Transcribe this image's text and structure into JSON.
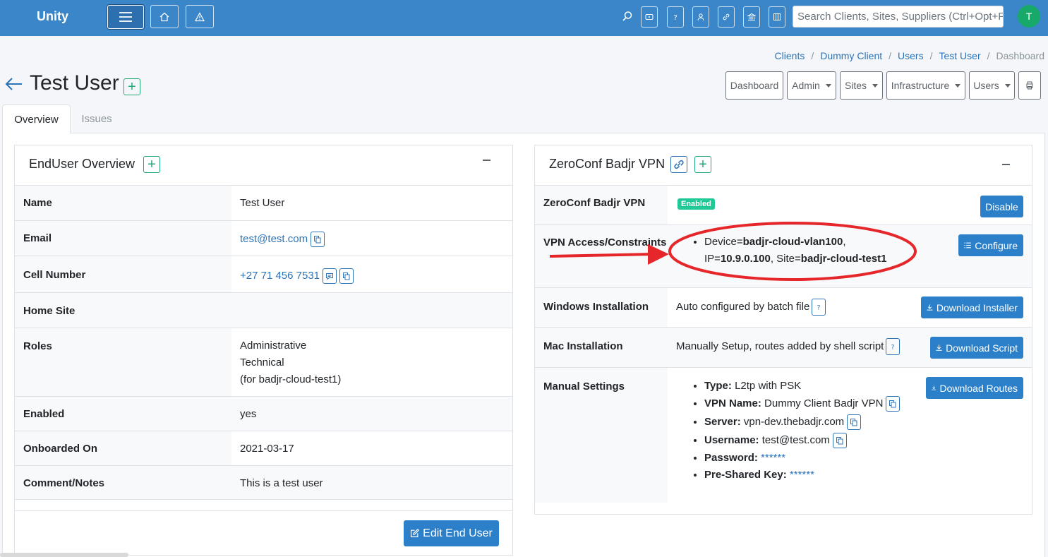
{
  "navbar": {
    "brand": "Unity",
    "search_placeholder": "Search Clients, Sites, Suppliers (Ctrl+Opt+F)",
    "avatar_initial": "T",
    "color": "#3a86c9"
  },
  "breadcrumb": {
    "items": [
      "Clients",
      "Dummy Client",
      "Users",
      "Test User"
    ],
    "current": "Dashboard"
  },
  "page": {
    "title": "Test User",
    "top_buttons": {
      "dashboard": "Dashboard",
      "admin": "Admin",
      "sites": "Sites",
      "infrastructure": "Infrastructure",
      "users": "Users"
    },
    "tabs": {
      "overview": "Overview",
      "issues": "Issues"
    }
  },
  "enduser": {
    "title": "EndUser Overview",
    "rows": {
      "name": {
        "label": "Name",
        "value": "Test User"
      },
      "email": {
        "label": "Email",
        "value": "test@test.com"
      },
      "cell": {
        "label": "Cell Number",
        "value": "+27 71 456 7531"
      },
      "home_site": {
        "label": "Home Site",
        "value": ""
      },
      "roles": {
        "label": "Roles",
        "values": [
          "Administrative",
          "Technical",
          "(for badjr-cloud-test1)"
        ]
      },
      "enabled": {
        "label": "Enabled",
        "value": "yes"
      },
      "onboarded": {
        "label": "Onboarded On",
        "value": "2021-03-17"
      },
      "comment": {
        "label": "Comment/Notes",
        "value": "This is a test user"
      }
    },
    "edit_button": "Edit End User"
  },
  "vpn": {
    "title": "ZeroConf Badjr VPN",
    "rows": {
      "status": {
        "label": "ZeroConf Badjr VPN",
        "badge": "Enabled",
        "button": "Disable"
      },
      "access": {
        "label": "VPN Access/Constraints",
        "device_prefix": "Device=",
        "device": "badjr-cloud-vlan100",
        "comma": ",",
        "ip_prefix": "IP=",
        "ip": "10.9.0.100",
        "site_prefix": ", Site=",
        "site": "badjr-cloud-test1",
        "button": "Configure"
      },
      "windows": {
        "label": "Windows Installation",
        "value": "Auto configured by batch file",
        "button": "Download Installer"
      },
      "mac": {
        "label": "Mac Installation",
        "value": "Manually Setup, routes added by shell script",
        "button": "Download Script"
      },
      "manual": {
        "label": "Manual Settings",
        "button": "Download Routes",
        "items": [
          {
            "key": "Type:",
            "value": "L2tp with PSK"
          },
          {
            "key": "VPN Name:",
            "value": "Dummy Client Badjr VPN"
          },
          {
            "key": "Server:",
            "value": "vpn-dev.thebadjr.com"
          },
          {
            "key": "Username:",
            "value": "test@test.com"
          },
          {
            "key": "Password:",
            "value": "******"
          },
          {
            "key": "Pre-Shared Key:",
            "value": "******"
          }
        ]
      }
    }
  },
  "colors": {
    "accent": "#2c80c9",
    "success": "#20a875",
    "badge": "#20c997",
    "annotation": "#e5262b"
  }
}
